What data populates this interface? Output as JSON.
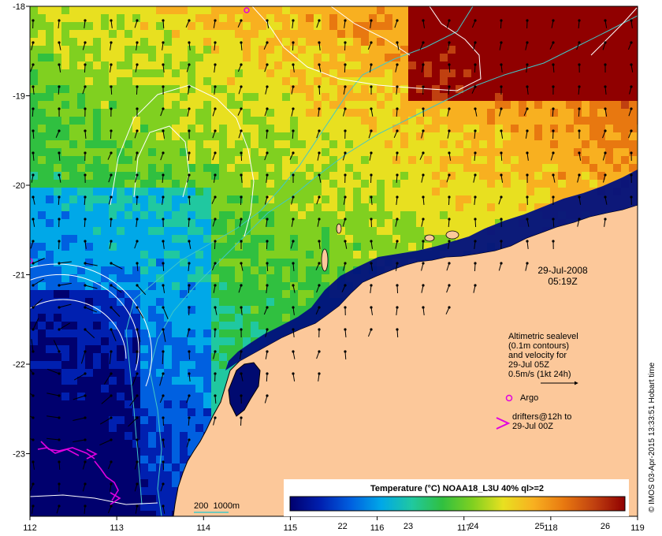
{
  "map": {
    "lon_ticks": [
      "112",
      "113",
      "114",
      "115",
      "116",
      "117",
      "118",
      "119"
    ],
    "lat_ticks": [
      "-18",
      "-19",
      "-20",
      "-21",
      "-22",
      "-23"
    ],
    "lon_range": [
      112,
      119
    ],
    "lat_range": [
      -23.7,
      -18
    ]
  },
  "timestamp": {
    "date": "29-Jul-2008",
    "time": "05:19Z"
  },
  "legend": {
    "velocity_lines": [
      "Altimetric sealevel",
      "(0.1m contours)",
      "and velocity for",
      "29-Jul 05Z",
      "0.5m/s (1kt 24h)"
    ],
    "argo_label": "Argo",
    "drifters_lines": [
      "drifters@12h to",
      "29-Jul 00Z"
    ],
    "bathy_label": "200  1000m"
  },
  "colorbar": {
    "title": "Temperature (°C) NOAA18_L3U 40% ql>=2",
    "tick_labels": [
      "22",
      "23",
      "24",
      "25",
      "26"
    ],
    "tick_values": [
      22,
      23,
      24,
      25,
      26
    ],
    "range": [
      21.2,
      26.3
    ],
    "stops": [
      "#00006e",
      "#0020b0",
      "#0060e0",
      "#00a8e8",
      "#20c8a0",
      "#30c040",
      "#80d020",
      "#e8e020",
      "#f8b020",
      "#e87810",
      "#c04010",
      "#900000"
    ]
  },
  "credit": "© IMOS 03-Apr-2015 13:33:51 Hobart time",
  "colors": {
    "land": "#fcc89a",
    "sealevel_contour": "#ffffff",
    "bathymetry": "#40c8c8",
    "argo": "#e000e0",
    "drifter": "#e000e0",
    "arrow": "#000000"
  }
}
